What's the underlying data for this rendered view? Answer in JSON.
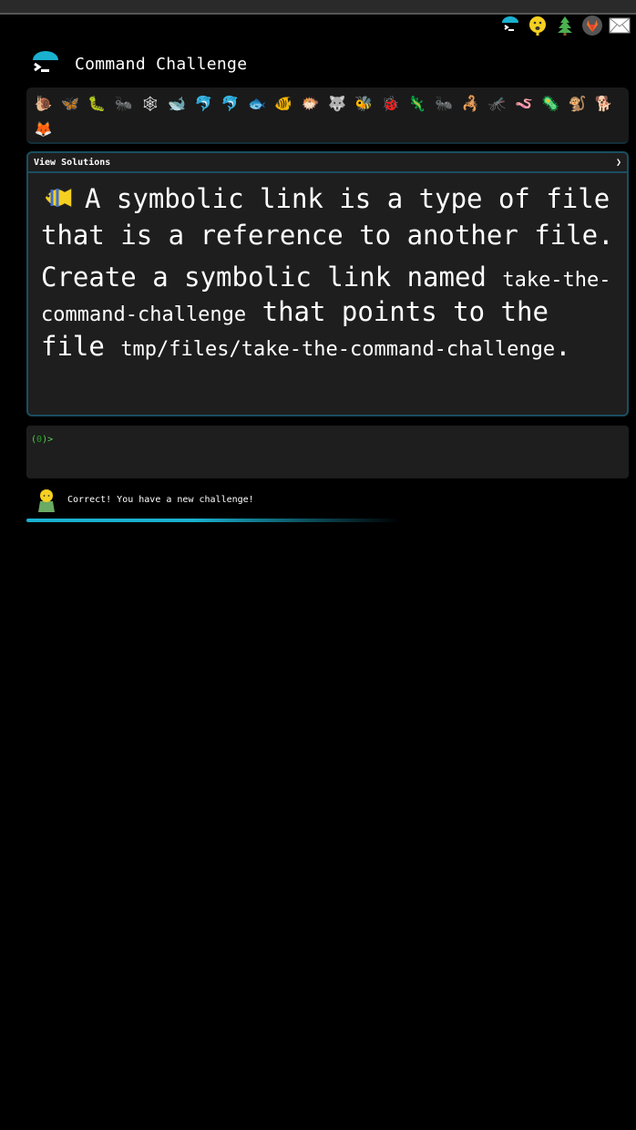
{
  "header": {
    "title": "Command Challenge"
  },
  "top_icons": [
    "terminal-umbrella-icon",
    "sad-face-icon",
    "tree-icon",
    "gitlab-icon",
    "mail-icon"
  ],
  "badges": [
    "🐌",
    "🦋",
    "🐛",
    "🐜",
    "🕸",
    "🐋",
    "🐬",
    "🐬",
    "🐟",
    "🐠",
    "🐡",
    "🐺",
    "🐝",
    "🐞",
    "🦎",
    "🐜",
    "🦂",
    "🦟",
    "🪱",
    "🦠",
    "🐒",
    "🐕",
    "🦊"
  ],
  "solutions": {
    "header_label": "View Solutions",
    "toggle": "❯",
    "intro": "A symbolic link is a type of file that is a reference to another file.",
    "task_prefix": "Create a symbolic link named ",
    "link_name": "take-the-command-challenge",
    "task_middle": " that points to the file ",
    "target_path": "tmp/files/take-the-command-challenge",
    "task_suffix": "."
  },
  "terminal": {
    "prompt_open": "(",
    "prompt_count": "0",
    "prompt_close": ")>"
  },
  "message": {
    "text": "Correct! You have a new challenge!"
  },
  "colors": {
    "accent": "#1ab0cf",
    "border": "#1b4e61",
    "prompt_green": "#4fd24f"
  }
}
